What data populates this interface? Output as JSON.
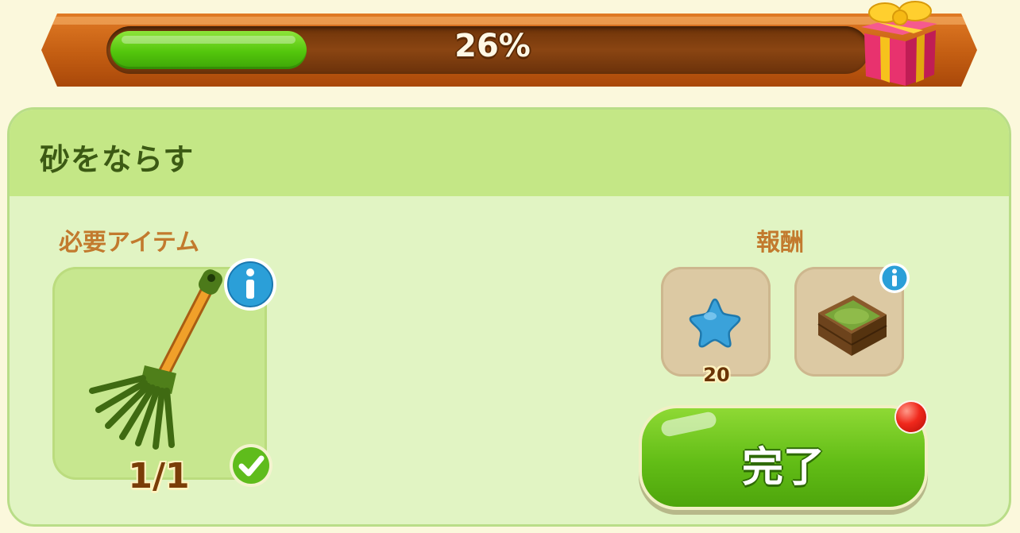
{
  "progress": {
    "percent_label": "26%",
    "fraction": 0.26,
    "reward_icon": "gift-box-icon"
  },
  "task": {
    "title": "砂をならす",
    "required_label": "必要アイテム",
    "required_item": {
      "icon": "rake-icon",
      "count": "1/1",
      "status": "complete"
    },
    "rewards_label": "報酬",
    "rewards": [
      {
        "icon": "blue-star-icon",
        "amount": "20"
      },
      {
        "icon": "sandbox-icon"
      }
    ],
    "complete_button": "完了"
  },
  "colors": {
    "panel_bg": "#e1f4c3",
    "header_bg": "#c4e786",
    "progress_fill": "#53c60c",
    "accent_orange": "#c27a2e",
    "button_green": "#62bd16",
    "notification": "#f0281c"
  }
}
